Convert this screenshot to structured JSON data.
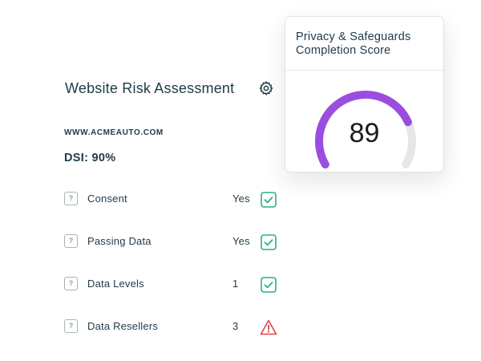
{
  "header": {
    "title": "Website Risk Assessment",
    "settings_icon": "gear-icon"
  },
  "site": {
    "domain": "WWW.ACMEAUTO.COM",
    "dsi": "DSI: 90%"
  },
  "rows": [
    {
      "help_icon": "?",
      "label": "Consent",
      "value": "Yes",
      "status": "check-icon"
    },
    {
      "help_icon": "?",
      "label": "Passing Data",
      "value": "Yes",
      "status": "check-icon"
    },
    {
      "help_icon": "?",
      "label": "Data Levels",
      "value": "1",
      "status": "check-icon"
    },
    {
      "help_icon": "?",
      "label": "Data Resellers",
      "value": "3",
      "status": "warning-icon"
    }
  ],
  "score_card": {
    "title_line1": "Privacy & Safeguards",
    "title_line2": "Completion Score",
    "score": "89",
    "score_value": 89,
    "score_max": 100
  },
  "colors": {
    "text": "#1f3b48",
    "gauge_fill": "#9b4de0",
    "gauge_track": "#e6e6e6",
    "check": "#2ab27b",
    "warning": "#e0454b"
  }
}
